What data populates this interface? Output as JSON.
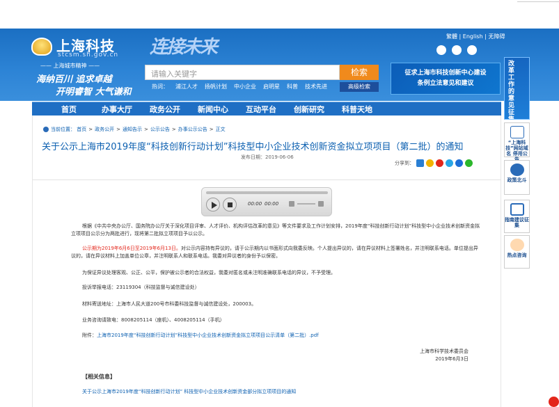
{
  "header": {
    "logo_title": "上海科技",
    "logo_domain": "stcsm.sh.gov.cn",
    "motto_head": "—— 上海城市精神 ——",
    "motto_line1": "海纳百川 追求卓越",
    "motto_line2": "开明睿智 大气谦和",
    "calligraphy": "连接未来",
    "top_links": "繁體 | English | 无障碍",
    "search": {
      "placeholder": "请输入关键字",
      "button": "检索",
      "advanced": "高级检索"
    },
    "hot_label": "热词：",
    "hot_words": [
      "浦江人才",
      "扬帆计划",
      "中小企业",
      "启明星",
      "科普",
      "技术先进"
    ],
    "banner_line1": "征求上海市科技创新中心建设",
    "banner_line2": "条例立法意见和建议"
  },
  "nav": [
    "首页",
    "办事大厅",
    "政务公开",
    "新闻中心",
    "互动平台",
    "创新研究",
    "科普天地"
  ],
  "sidebar": {
    "vertical_ad": "改革工作的意见征集众舞上海科技改",
    "widgets": [
      {
        "label": "“上海科技”网站域名 停用公告"
      },
      {
        "label": "政策北斗"
      },
      {
        "label": "指南建议征集"
      },
      {
        "label": "热点咨询"
      }
    ]
  },
  "breadcrumb": {
    "prefix": "当前位置：",
    "items": [
      "首页",
      "政务公开",
      "通知告示",
      "公示公告",
      "办事公示公告",
      "正文"
    ]
  },
  "article": {
    "title": "关于公示上海市2019年度“科技创新行动计划”科技型中小企业技术创新资金拟立项项目（第二批）的通知",
    "pub_date": "发布日期：2019-06-06",
    "share_label": "分享到：",
    "player": {
      "time_current": "00:00",
      "time_total": "00:00"
    },
    "p1": "根据《中共中央办公厅、国务院办公厅关于深化项目评审、人才评价、机构评估改革的意见》等文件要求及工作计划安排，2019年度“科技创新行动计划”科技型中小企业技术创新资金拟立项项目公示分为两批进行，现将第二批拟立项项目予以公示。",
    "p2_red": "公示期为2019年6月6日至2019年6月13日。",
    "p2_rest": "对公示内容持有异议的，请于公示期内以书面形式向我委反映。个人提出异议的，请在异议材料上签署姓名，并注明联系电话。单位提出异议的，请在异议材料上加盖单位公章，并注明联系人和联系电话。我委对异议者的身份予以保密。",
    "p3": "为保证异议处理客观、公正、公平，保护被公示者的合法权益，我委对匿名或未注明准确联系电话的异议，不予受理。",
    "p4": "投诉举报电话：23119304（科技监督与诚信建设处）",
    "p5": "材料寄送地址：上海市人民大道200号市科委科技监督与诚信建设处，200003。",
    "p6": "业务咨询请致电：8008205114（座机）、4008205114（手机）",
    "attach_label": "附件：",
    "attach_link": "上海市2019年度“科技创新行动计划”科技型中小企业技术创新资金拟立项项目公示清单（第二批）.pdf",
    "sign_org": "上海市科学技术委员会",
    "sign_date": "2019年6月3日",
    "related_heading": "【相关信息】",
    "related_link": "关于公示上海市2019年度“科技创新行动计划” 科技型中小企业技术创新资金部分拟立项项目的通知"
  }
}
